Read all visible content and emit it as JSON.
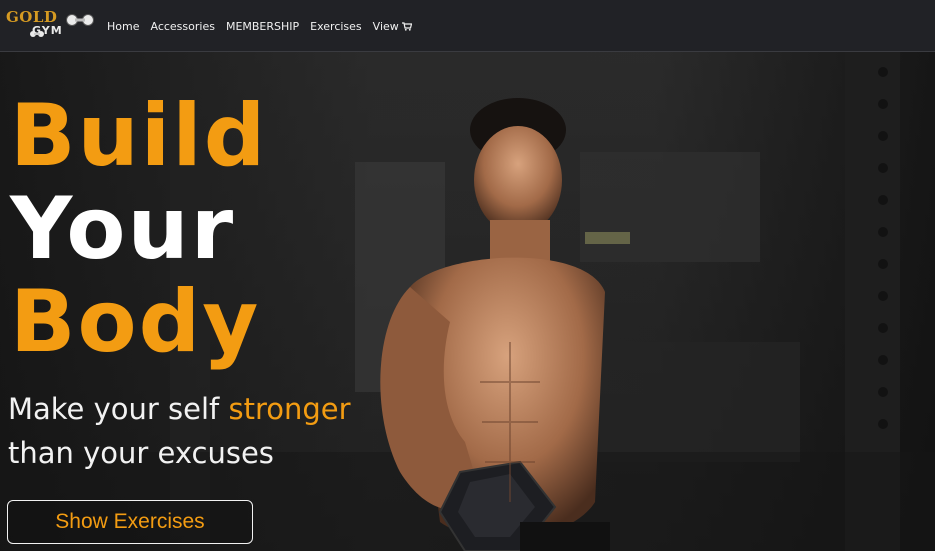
{
  "brand": {
    "logo_top": "GOLD",
    "logo_bottom": "GYM",
    "gold_color": "#d59a22"
  },
  "nav": {
    "items": [
      {
        "label": "Home"
      },
      {
        "label": "Accessories"
      },
      {
        "label": "MEMBERSHIP"
      },
      {
        "label": "Exercises"
      },
      {
        "label": "View",
        "icon": "cart-icon"
      }
    ]
  },
  "hero": {
    "headline": [
      "Build",
      "Your",
      "Body"
    ],
    "tagline_part1": "Make your self ",
    "tagline_accent": "stronger",
    "tagline_line2": "than your excuses",
    "cta_label": "Show Exercises",
    "accent_color": "#f39c12"
  }
}
